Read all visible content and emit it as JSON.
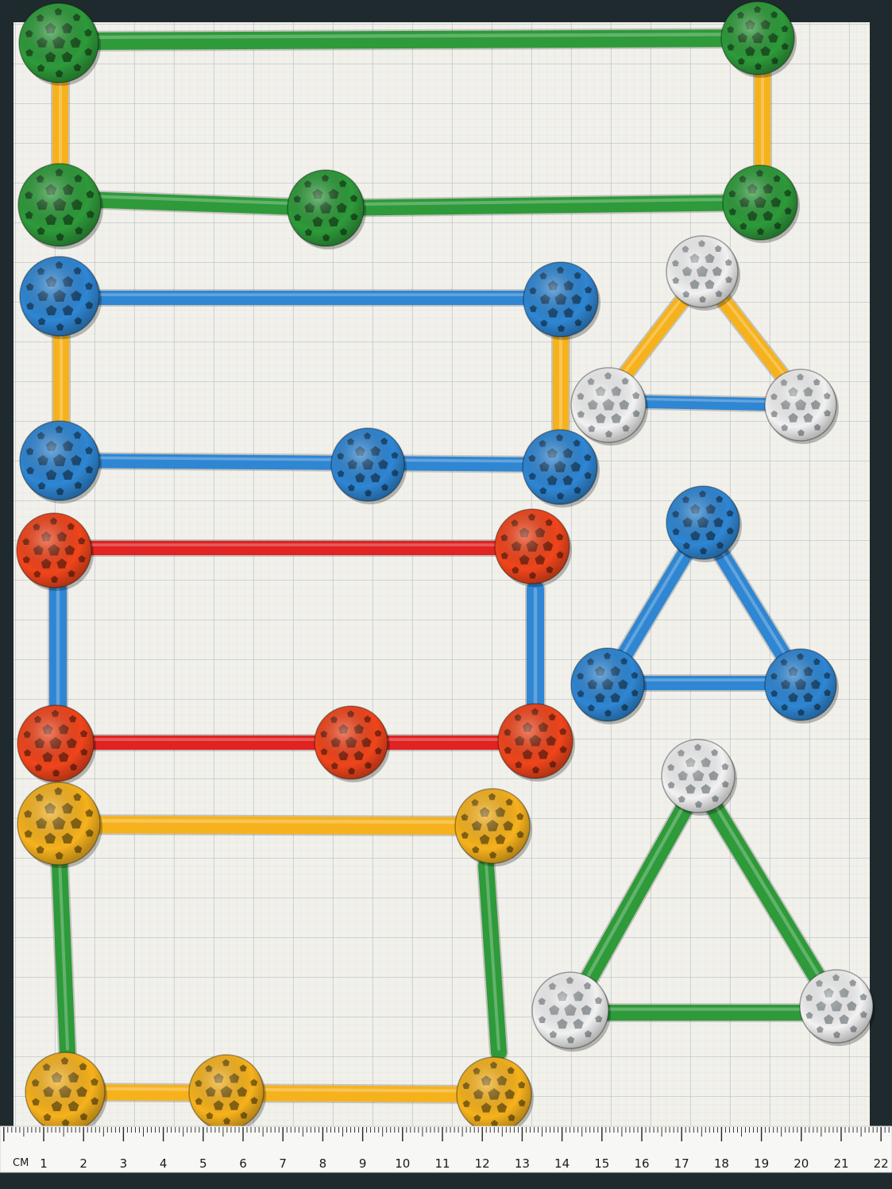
{
  "colors": {
    "green": "#2e9a3a",
    "yellow": "#f6b21d",
    "blue": "#2f86d3",
    "red": "#e02323",
    "orange": "#f0451c",
    "white": "#f2f2f2",
    "paper": "#f1f0ea",
    "grid": "#c9cfd1",
    "background": "#1f2a2e",
    "ruler": "#f7f7f5"
  },
  "icons": [
    "connector-ball",
    "rod"
  ],
  "ruler": {
    "unit_label": "CM",
    "numbers": [
      "1",
      "2",
      "3",
      "4",
      "5",
      "6",
      "7",
      "8",
      "9",
      "10",
      "11",
      "12",
      "13",
      "14",
      "15",
      "16",
      "17",
      "18",
      "19",
      "20",
      "21",
      "22"
    ]
  }
}
